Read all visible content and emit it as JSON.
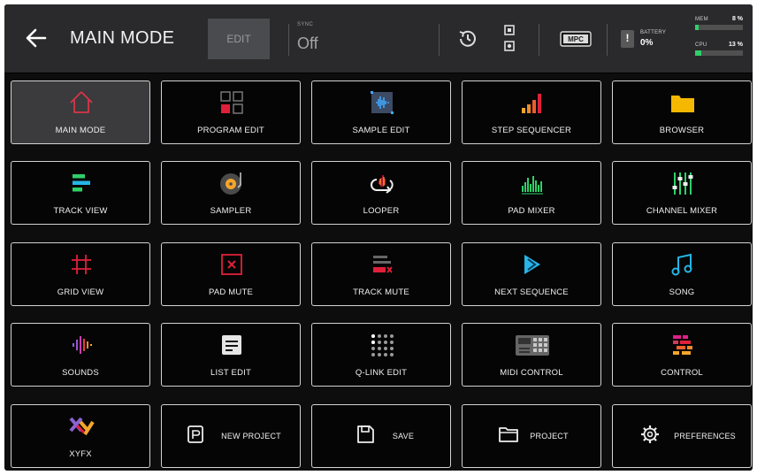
{
  "header": {
    "title": "MAIN MODE",
    "edit_label": "EDIT",
    "sync_label": "SYNC",
    "sync_value": "Off",
    "battery_label": "BATTERY",
    "battery_value": "0%",
    "mem_label": "MEM",
    "mem_value": "8 %",
    "mem_level": 8,
    "cpu_label": "CPU",
    "cpu_value": "13 %",
    "cpu_level": 13,
    "mpc_label": "MPC"
  },
  "tiles": [
    {
      "label": "MAIN MODE",
      "icon": "house-icon"
    },
    {
      "label": "PROGRAM EDIT",
      "icon": "program-grid-icon"
    },
    {
      "label": "SAMPLE EDIT",
      "icon": "sample-waveform-icon"
    },
    {
      "label": "STEP SEQUENCER",
      "icon": "step-bars-icon"
    },
    {
      "label": "BROWSER",
      "icon": "folder-icon"
    },
    {
      "label": "TRACK VIEW",
      "icon": "track-lines-icon"
    },
    {
      "label": "SAMPLER",
      "icon": "vinyl-icon"
    },
    {
      "label": "LOOPER",
      "icon": "loop-icon"
    },
    {
      "label": "PAD MIXER",
      "icon": "level-bars-icon"
    },
    {
      "label": "CHANNEL MIXER",
      "icon": "faders-icon"
    },
    {
      "label": "GRID VIEW",
      "icon": "grid-hash-icon"
    },
    {
      "label": "PAD MUTE",
      "icon": "pad-mute-icon"
    },
    {
      "label": "TRACK MUTE",
      "icon": "track-mute-icon"
    },
    {
      "label": "NEXT SEQUENCE",
      "icon": "next-arrow-icon"
    },
    {
      "label": "SONG",
      "icon": "music-note-icon"
    },
    {
      "label": "SOUNDS",
      "icon": "sound-wave-icon"
    },
    {
      "label": "LIST EDIT",
      "icon": "list-icon"
    },
    {
      "label": "Q-LINK EDIT",
      "icon": "knob-grid-icon"
    },
    {
      "label": "MIDI CONTROL",
      "icon": "midi-controller-icon"
    },
    {
      "label": "CONTROL",
      "icon": "control-blocks-icon"
    },
    {
      "label": "XYFX",
      "icon": "xy-icon"
    },
    {
      "label": "NEW PROJECT",
      "icon": "new-project-icon"
    },
    {
      "label": "SAVE",
      "icon": "save-icon"
    },
    {
      "label": "PROJECT",
      "icon": "project-folder-icon"
    },
    {
      "label": "PREFERENCES",
      "icon": "gear-icon"
    }
  ]
}
